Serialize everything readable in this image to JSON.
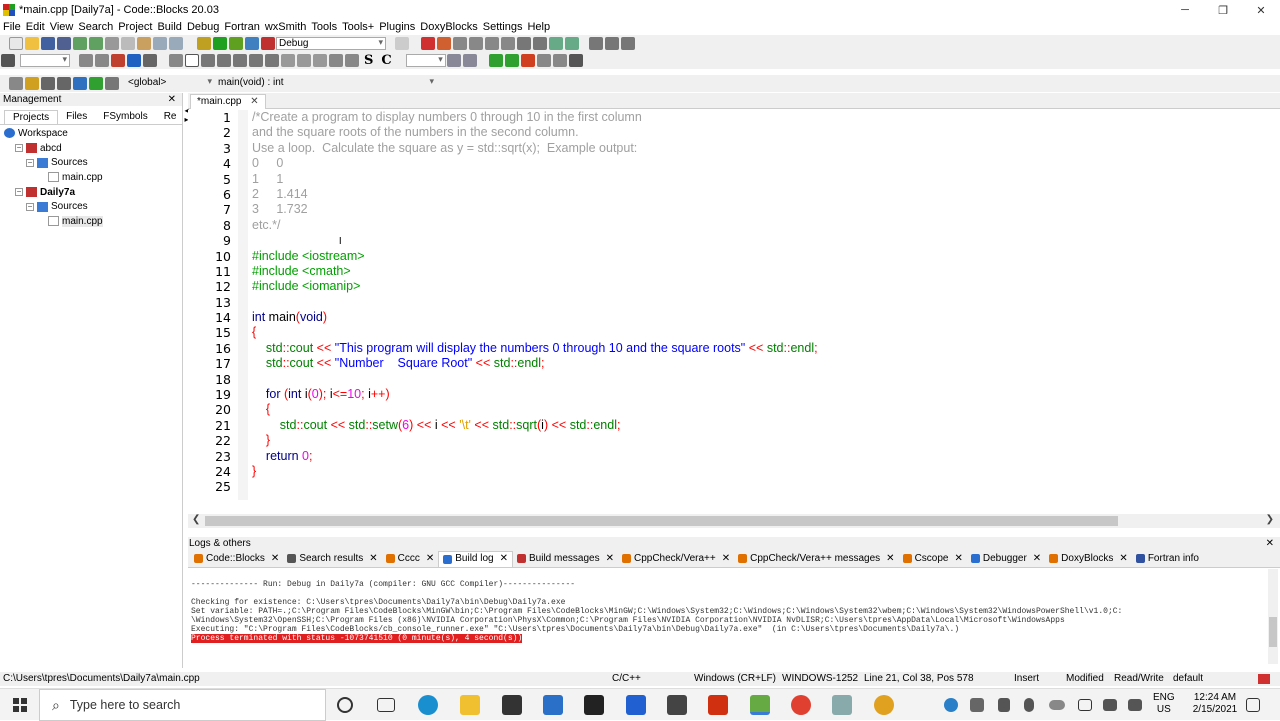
{
  "window": {
    "title": "*main.cpp [Daily7a] - Code::Blocks 20.03",
    "min": "─",
    "max": "❐",
    "close": "✕"
  },
  "menu": [
    "File",
    "Edit",
    "View",
    "Search",
    "Project",
    "Build",
    "Debug",
    "Fortran",
    "wxSmith",
    "Tools",
    "Tools+",
    "Plugins",
    "DoxyBlocks",
    "Settings",
    "Help"
  ],
  "toolbar": {
    "build_target": "Debug",
    "scope": "<global>",
    "function": "main(void) : int",
    "letter_s": "S",
    "letter_c": "C"
  },
  "management": {
    "title": "Management",
    "close": "✕",
    "tabs": [
      "Projects",
      "Files",
      "FSymbols",
      "Re"
    ],
    "arrows": "◂ ▸",
    "tree": [
      {
        "label": "Workspace",
        "indent": 0
      },
      {
        "label": "abcd",
        "indent": 1,
        "bold": false
      },
      {
        "label": "Sources",
        "indent": 2
      },
      {
        "label": "main.cpp",
        "indent": 3
      },
      {
        "label": "Daily7a",
        "indent": 1,
        "bold": true
      },
      {
        "label": "Sources",
        "indent": 2
      },
      {
        "label": "main.cpp",
        "indent": 3
      }
    ]
  },
  "editor": {
    "tab": "*main.cpp",
    "tab_close": "✕",
    "line_numbers": [
      "1",
      "2",
      "3",
      "4",
      "5",
      "6",
      "7",
      "8",
      "9",
      "10",
      "11",
      "12",
      "13",
      "14",
      "15",
      "16",
      "17",
      "18",
      "19",
      "20",
      "21",
      "22",
      "23",
      "24",
      "25"
    ]
  },
  "logs": {
    "title": "Logs & others",
    "close": "✕",
    "tabs": [
      {
        "label": "Code::Blocks",
        "color": "#e07000"
      },
      {
        "label": "Search results",
        "color": "#555"
      },
      {
        "label": "Cccc",
        "color": "#e07000"
      },
      {
        "label": "Build log",
        "color": "#2a6fd0",
        "active": true
      },
      {
        "label": "Build messages",
        "color": "#c03030"
      },
      {
        "label": "CppCheck/Vera++",
        "color": "#e07000"
      },
      {
        "label": "CppCheck/Vera++ messages",
        "color": "#e07000"
      },
      {
        "label": "Cscope",
        "color": "#e07000"
      },
      {
        "label": "Debugger",
        "color": "#2a6fd0"
      },
      {
        "label": "DoxyBlocks",
        "color": "#e07000"
      },
      {
        "label": "Fortran info",
        "color": "#3050a0"
      }
    ],
    "lines": [
      "-------------- Run: Debug in Daily7a (compiler: GNU GCC Compiler)---------------",
      "",
      "Checking for existence: C:\\Users\\tpres\\Documents\\Daily7a\\bin\\Debug\\Daily7a.exe",
      "Set variable: PATH=.;C:\\Program Files\\CodeBlocks\\MinGW\\bin;C:\\Program Files\\CodeBlocks\\MinGW;C:\\Windows\\System32;C:\\Windows;C:\\Windows\\System32\\wbem;C:\\Windows\\System32\\WindowsPowerShell\\v1.0;C:",
      "\\Windows\\System32\\OpenSSH;C:\\Program Files (x86)\\NVIDIA Corporation\\PhysX\\Common;C:\\Program Files\\NVIDIA Corporation\\NVIDIA NvDLISR;C:\\Users\\tpres\\AppData\\Local\\Microsoft\\WindowsApps",
      "Executing: \"C:\\Program Files\\CodeBlocks/cb_console_runner.exe\" \"C:\\Users\\tpres\\Documents\\Daily7a\\bin\\Debug\\Daily7a.exe\"  (in C:\\Users\\tpres\\Documents\\Daily7a\\.)",
      "Process terminated with status -1073741510 (0 minute(s), 4 second(s))"
    ]
  },
  "status": {
    "path": "C:\\Users\\tpres\\Documents\\Daily7a\\main.cpp",
    "lang": "C/C++",
    "eol": "Windows (CR+LF)",
    "enc": "WINDOWS-1252",
    "pos": "Line 21, Col 38, Pos 578",
    "mode": "Insert",
    "modified": "Modified",
    "rw": "Read/Write",
    "profile": "default"
  },
  "taskbar": {
    "search_placeholder": "Type here to search",
    "lang": "ENG",
    "region": "US",
    "time": "12:24 AM",
    "date": "2/15/2021"
  }
}
